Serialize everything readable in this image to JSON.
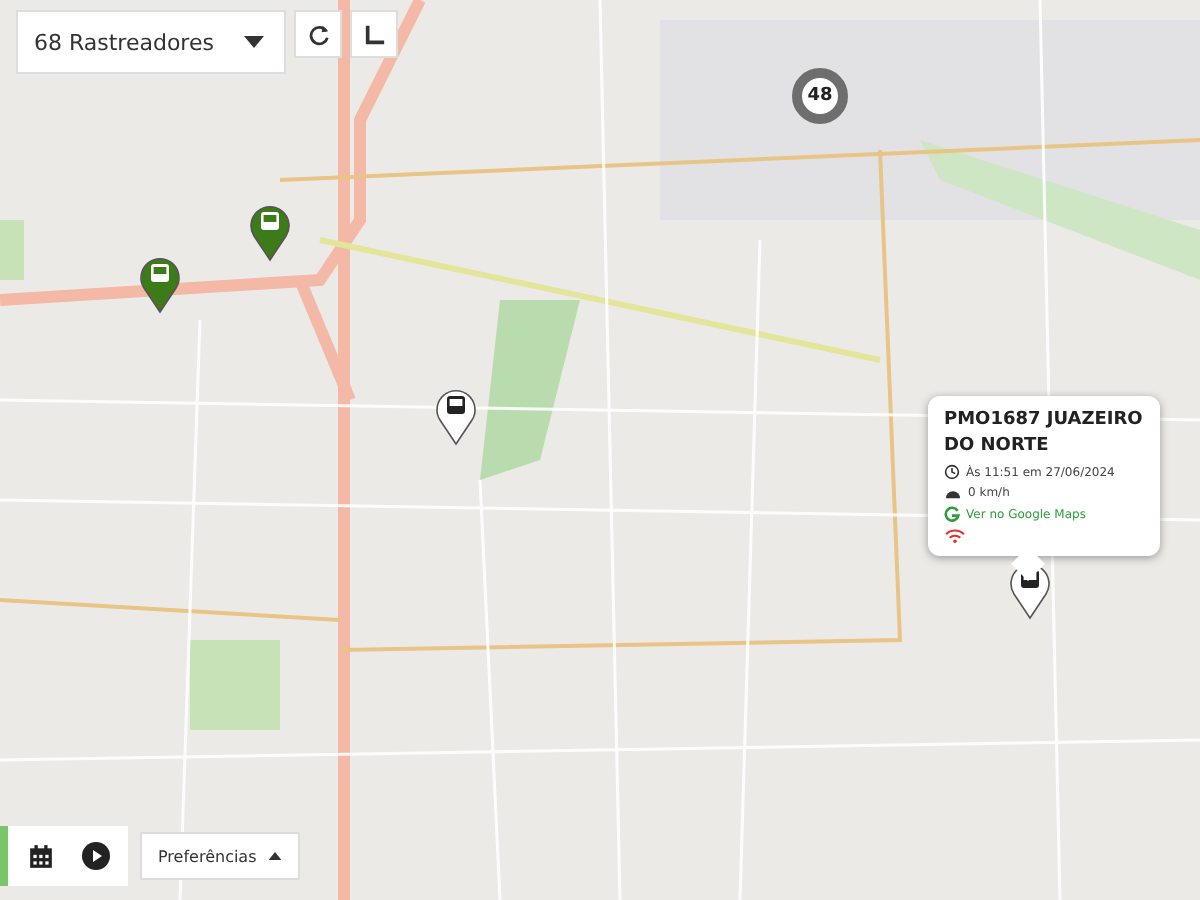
{
  "tracker_select": {
    "value": "68 Rastreadores"
  },
  "markers": [
    {
      "kind": "pin",
      "color": "#3d7a1a"
    },
    {
      "kind": "pin",
      "color": "#3d7a1a"
    },
    {
      "kind": "pin",
      "color": "#ffffff"
    },
    {
      "kind": "pin",
      "color": "#ffffff"
    },
    {
      "kind": "cluster",
      "count": "48"
    }
  ],
  "popup": {
    "title": "PMO1687 JUAZEIRO DO NORTE",
    "time": "Às 11:51 em 27/06/2024",
    "speed": "0 km/h",
    "link": "Ver no Google Maps"
  },
  "bottom_bar": {
    "preferences": "Preferências"
  }
}
